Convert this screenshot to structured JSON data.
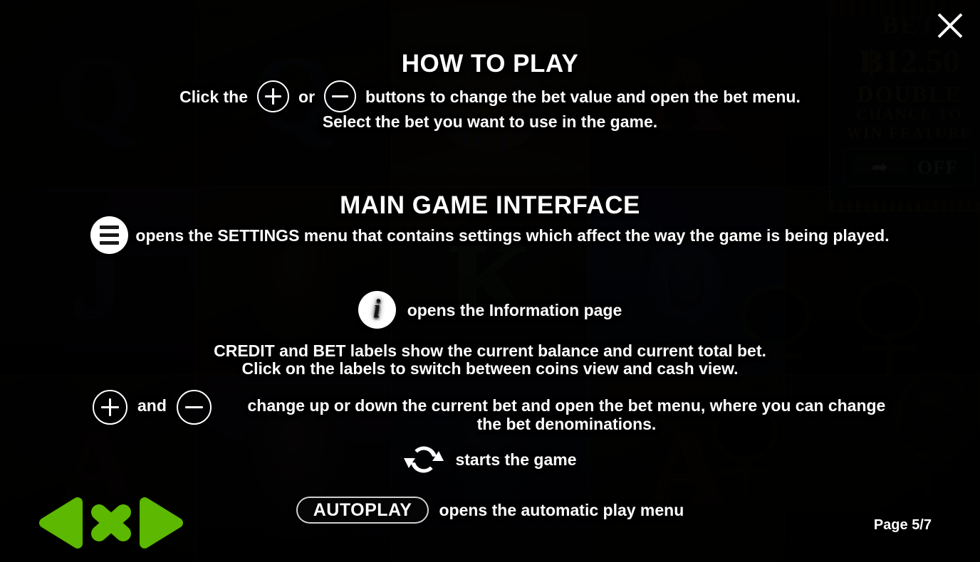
{
  "meta": {
    "accent_green": "#5cb800",
    "text_color": "#ffffff"
  },
  "close_button": {
    "label": "×",
    "icon": "close-icon"
  },
  "how_to_play": {
    "heading": "HOW TO PLAY",
    "line1_before": "Click the",
    "plus_icon": "plus-circle-icon",
    "line1_middle": "or",
    "minus_icon": "minus-circle-icon",
    "line1_after": "buttons to change the bet value and open the bet menu.",
    "line2": "Select the bet you want to use in the game."
  },
  "main_game_interface": {
    "heading": "MAIN GAME INTERFACE",
    "settings": {
      "icon": "hamburger-menu-icon",
      "text": "opens the SETTINGS menu that contains settings which affect the way the game is being played."
    },
    "info": {
      "icon": "info-icon",
      "text": "opens the Information page"
    },
    "credit_bet": {
      "line1": "CREDIT and BET labels show the current balance and current total bet.",
      "line2": "Click on the labels to switch between coins view and cash view."
    },
    "bet_controls": {
      "plus_icon": "plus-circle-icon",
      "conjunction": "and",
      "minus_icon": "minus-circle-icon",
      "text_line1": "change up or down the current bet and open the bet menu, where you can change",
      "text_line2": "the bet denominations."
    },
    "spin": {
      "icon": "spin-refresh-icon",
      "text": "starts the game"
    },
    "autoplay": {
      "button_label": "AUTOPLAY",
      "text": "opens the automatic play menu"
    }
  },
  "footer": {
    "prev_icon": "previous-arrow-icon",
    "close_icon": "close-x-icon",
    "next_icon": "next-arrow-icon",
    "page_indicator": "Page 5/7"
  },
  "background_panel": {
    "bet_label": "BET",
    "bet_amount": "฿12.50",
    "feature_line1": "DOUBLE",
    "feature_line2": "CHANCE TO",
    "feature_line3": "WIN FEATURE",
    "toggle_state": "OFF",
    "toggle_arrow": "➡"
  },
  "background_symbols": {
    "row1": [
      "Q",
      "Q",
      "",
      "A",
      "A"
    ],
    "row2": [
      "J",
      "",
      "K",
      "Q",
      ""
    ],
    "row3": [
      "A",
      "",
      "",
      "A",
      ""
    ]
  }
}
